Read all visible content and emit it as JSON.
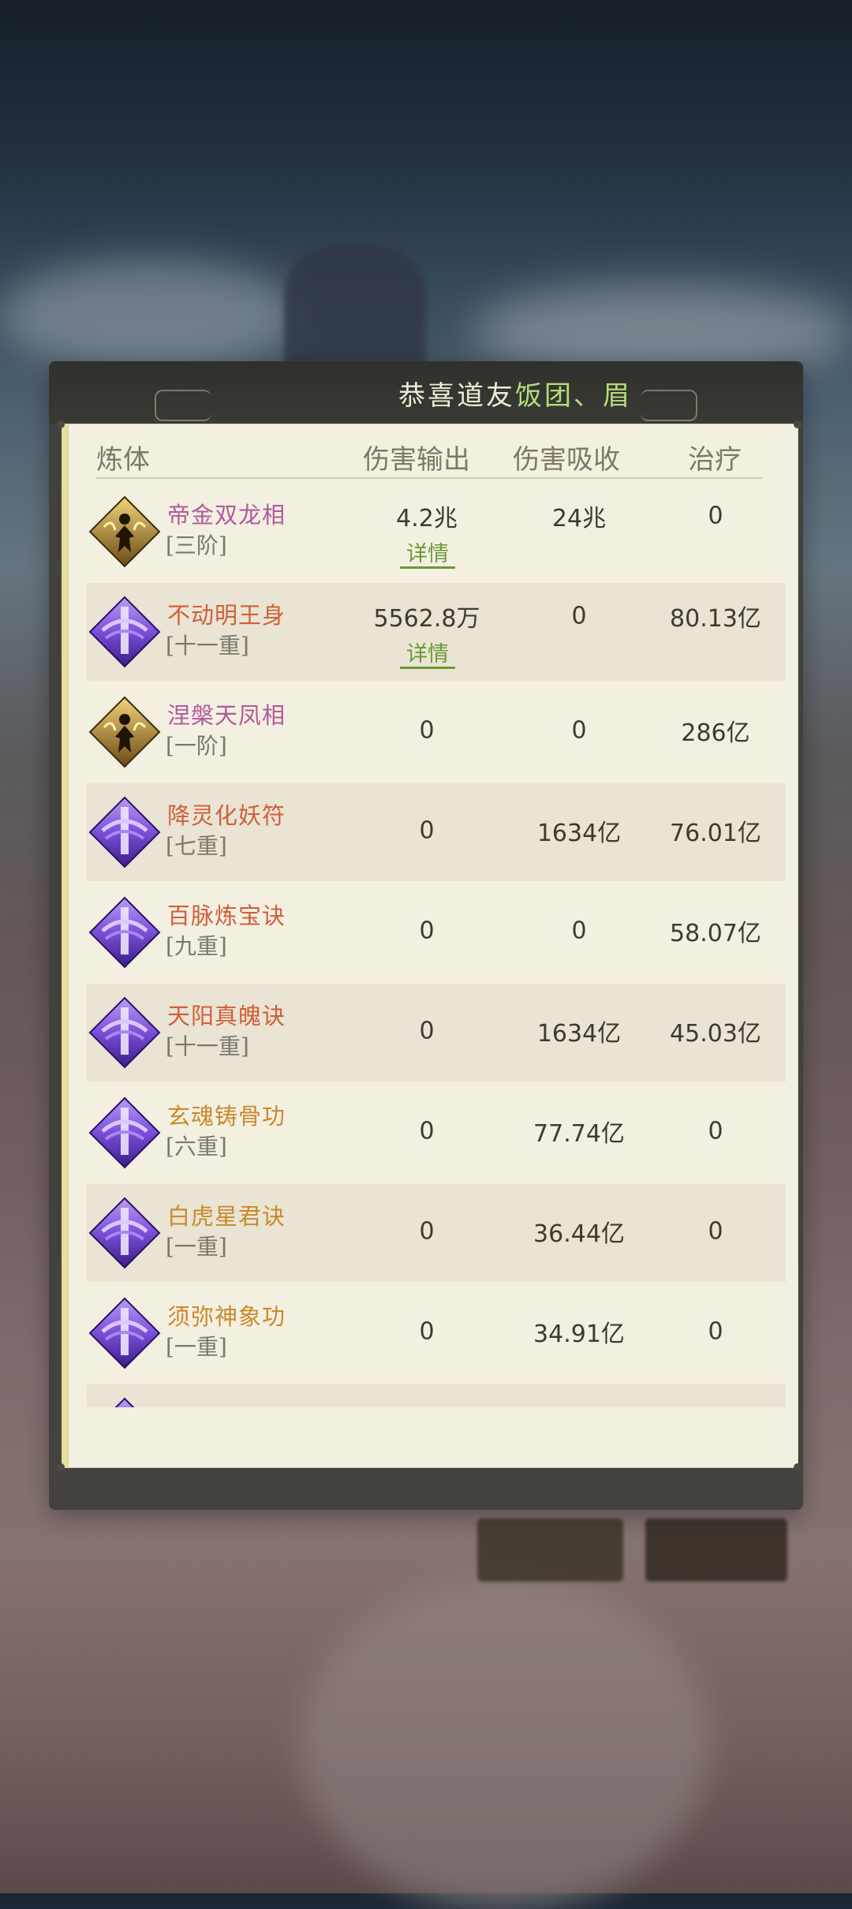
{
  "panel": {
    "title_prefix": "恭喜道友",
    "title_name": "饭团、眉"
  },
  "columns": [
    "炼体",
    "伤害输出",
    "伤害吸收",
    "治疗"
  ],
  "rows": [
    {
      "name": "帝金双龙相",
      "level": "[三阶]",
      "damage": "4.2兆",
      "has_detail": true,
      "absorb": "24兆",
      "heal": "0",
      "name_color": "#b25a9a",
      "icon": "golden-figure-icon"
    },
    {
      "name": "不动明王身",
      "level": "[十一重]",
      "damage": "5562.8万",
      "has_detail": true,
      "absorb": "0",
      "heal": "80.13亿",
      "name_color": "#cf5f3a",
      "icon": "purple-sword-icon"
    },
    {
      "name": "涅槃天凤相",
      "level": "[一阶]",
      "damage": "0",
      "has_detail": false,
      "absorb": "0",
      "heal": "286亿",
      "name_color": "#b25a9a",
      "icon": "golden-figure-icon"
    },
    {
      "name": "降灵化妖符",
      "level": "[七重]",
      "damage": "0",
      "has_detail": false,
      "absorb": "1634亿",
      "heal": "76.01亿",
      "name_color": "#cf5f3a",
      "icon": "purple-sword-icon"
    },
    {
      "name": "百脉炼宝诀",
      "level": "[九重]",
      "damage": "0",
      "has_detail": false,
      "absorb": "0",
      "heal": "58.07亿",
      "name_color": "#cf5f3a",
      "icon": "purple-sword-icon"
    },
    {
      "name": "天阳真魄诀",
      "level": "[十一重]",
      "damage": "0",
      "has_detail": false,
      "absorb": "1634亿",
      "heal": "45.03亿",
      "name_color": "#cf5f3a",
      "icon": "purple-sword-icon"
    },
    {
      "name": "玄魂铸骨功",
      "level": "[六重]",
      "damage": "0",
      "has_detail": false,
      "absorb": "77.74亿",
      "heal": "0",
      "name_color": "#c98a2a",
      "icon": "purple-sword-icon"
    },
    {
      "name": "白虎星君诀",
      "level": "[一重]",
      "damage": "0",
      "has_detail": false,
      "absorb": "36.44亿",
      "heal": "0",
      "name_color": "#c98a2a",
      "icon": "purple-sword-icon"
    },
    {
      "name": "须弥神象功",
      "level": "[一重]",
      "damage": "0",
      "has_detail": false,
      "absorb": "34.91亿",
      "heal": "0",
      "name_color": "#c98a2a",
      "icon": "purple-sword-icon"
    }
  ],
  "detail_label": "详情"
}
